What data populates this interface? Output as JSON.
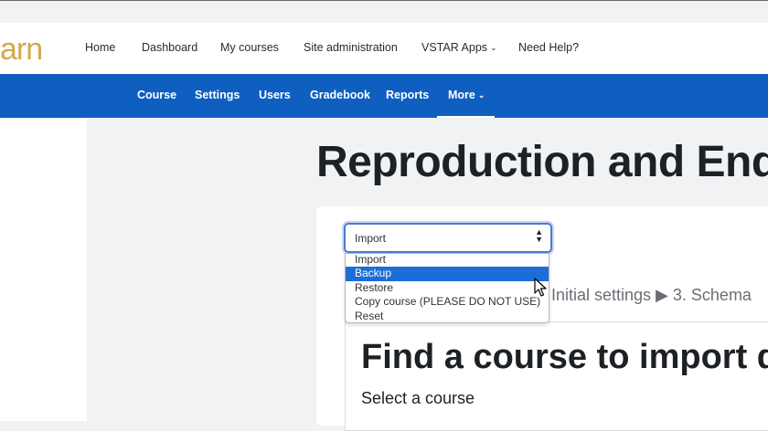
{
  "brand": {
    "logo_text": "arn",
    "logo_color": "#d2a94d"
  },
  "navbar": {
    "links": [
      "Home",
      "Dashboard",
      "My courses",
      "Site administration",
      "VSTAR Apps",
      "Need Help?"
    ]
  },
  "course_nav": {
    "links": [
      "Course",
      "Settings",
      "Users",
      "Gradebook",
      "Reports",
      "More"
    ],
    "active": "More",
    "bg_color": "#0e5fc0"
  },
  "page": {
    "title": "Reproduction and Endo"
  },
  "action_select": {
    "value": "Import",
    "options": [
      "Import",
      "Backup",
      "Restore",
      "Copy course (PLEASE DO NOT USE)",
      "Reset"
    ],
    "highlighted": "Backup"
  },
  "steps_text": "Initial settings ▶ 3. Schema",
  "section": {
    "title": "Find a course to import da",
    "subtitle": "Select a course"
  }
}
